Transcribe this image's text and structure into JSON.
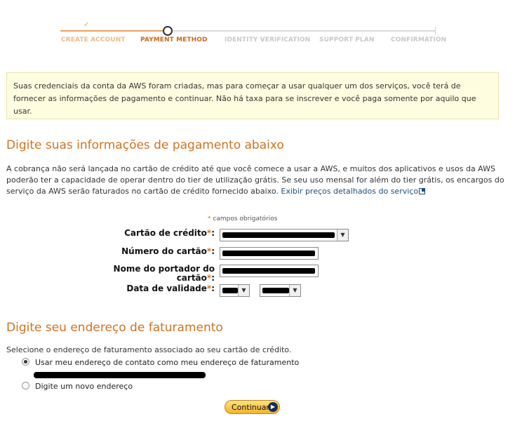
{
  "tracker": {
    "steps": [
      {
        "label": "CREATE ACCOUNT",
        "state": "done"
      },
      {
        "label": "PAYMENT METHOD",
        "state": "current"
      },
      {
        "label": "IDENTITY VERIFICATION",
        "state": "future"
      },
      {
        "label": "SUPPORT PLAN",
        "state": "future"
      },
      {
        "label": "CONFIRMATION",
        "state": "future"
      }
    ],
    "check_glyph": "✓"
  },
  "info": {
    "text": "Suas credenciais da conta da AWS foram criadas, mas para começar a usar qualquer um dos serviços, você terá de fornecer as informações de pagamento e continuar. Não há taxa para se inscrever e você paga somente por aquilo que usar."
  },
  "payment": {
    "title": "Digite suas informações de pagamento abaixo",
    "description": "A cobrança não será lançada no cartão de crédito até que você comece a usar a AWS, e muitos dos aplicativos e usos da AWS poderão ter a capacidade de operar dentro do tier de utilização grátis. Se seu uso mensal for além do tier grátis, os encargos do serviço da AWS serão faturados no cartão de crédito fornecido abaixo.",
    "pricing_link": "Exibir preços detalhados do serviço",
    "required_note": "campos obrigatórios",
    "asterisk": "*",
    "labels": {
      "card_type": "Cartão de crédito",
      "card_number": "Número do cartão",
      "holder_line1": "Nome do portador do",
      "holder_line2": "cartão",
      "expiry": "Data de validade"
    },
    "colon": ":"
  },
  "billing": {
    "title": "Digite seu endereço de faturamento",
    "description": "Selecione o endereço de faturamento associado ao seu cartão de crédito.",
    "option_contact": "Usar meu endereço de contato como meu endereço de faturamento",
    "option_new": "Digite um novo endereço",
    "selected": "contact"
  },
  "continue_label": "Continuar",
  "colors": {
    "accent": "#d0731e",
    "link": "#1c4f7a",
    "info_bg": "#fffde0"
  }
}
